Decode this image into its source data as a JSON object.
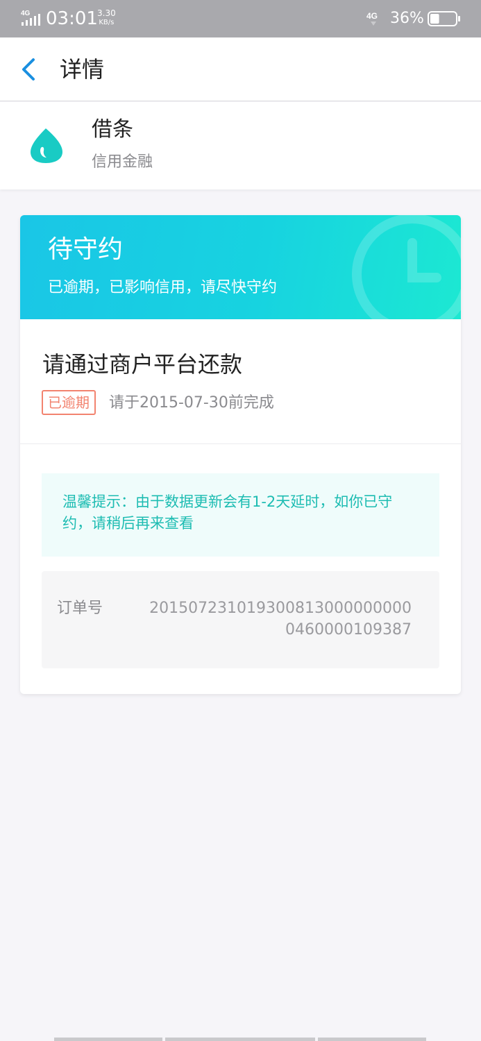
{
  "status_bar": {
    "network_left": "4G",
    "time": "03:01",
    "speed_value": "3.30",
    "speed_unit": "KB/s",
    "network_right": "4G",
    "battery": "36%",
    "battery_level": 0.36
  },
  "nav": {
    "title": "详情",
    "back_icon": "chevron-left-icon",
    "accent_color": "#1a8fe0"
  },
  "app": {
    "name": "借条",
    "category": "信用金融",
    "logo_icon": "water-drop-icon",
    "logo_color": "#19cbc4"
  },
  "status_card": {
    "title": "待守约",
    "subtitle": "已逾期，已影响信用，请尽快守约",
    "gradient_start": "#1ac6e6",
    "gradient_end": "#1ce8d2"
  },
  "task": {
    "title": "请通过商户平台还款",
    "badge": "已逾期",
    "deadline": "请于2015-07-30前完成",
    "badge_color": "#f2836f"
  },
  "tip": {
    "text": "温馨提示：由于数据更新会有1-2天延时，如你已守约，请稍后再来查看",
    "color": "#1dbcb2"
  },
  "order": {
    "label": "订单号",
    "value": "2015072310193008130000000000460000109387"
  }
}
